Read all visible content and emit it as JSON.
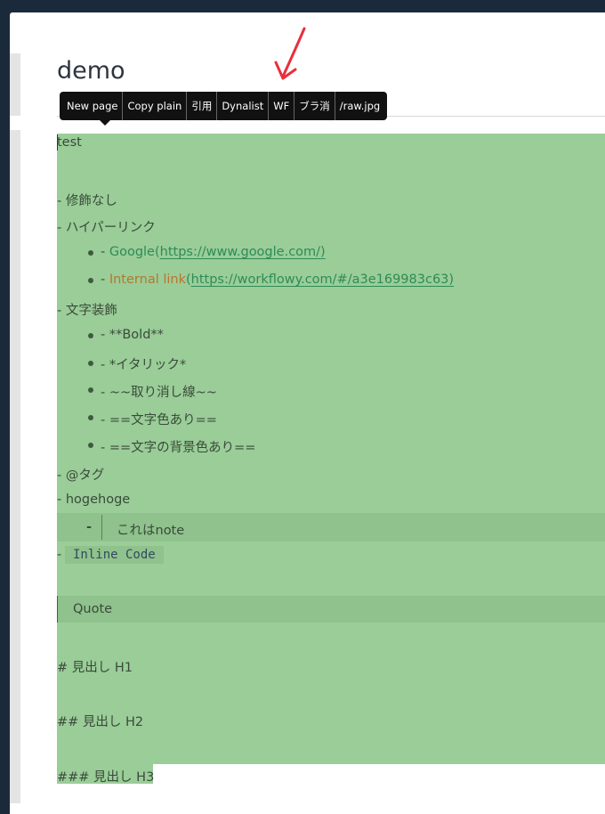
{
  "page": {
    "title": "demo"
  },
  "toolbar": {
    "buttons": [
      "New page",
      "Copy plain",
      "引用",
      "Dynalist",
      "WF",
      "ブラ消",
      "/raw.jpg"
    ]
  },
  "colors": {
    "background": "#1b2a3a",
    "editor_highlight": "#9acd98",
    "arrow": "#e8303c"
  },
  "editor": {
    "line_test": "test",
    "line_plain": "- 修飾なし",
    "line_hyperlink": "- ハイパーリンク",
    "google": {
      "prefix": "- ",
      "text": "Google",
      "open": "(",
      "url": "https://www.google.com/)"
    },
    "internal": {
      "prefix": "- ",
      "text": "Internal link",
      "open": "(",
      "url": "https://workflowy.com/#/a3e169983c63)"
    },
    "line_deco": "- 文字装飾",
    "deco_items": [
      "- **Bold**",
      "- *イタリック*",
      "- ~~取り消し線~~",
      "- ==文字色あり==",
      "- ==文字の背景色あり=="
    ],
    "line_tag": "- @タグ",
    "line_hoge": "- hogehoge",
    "note_dash": "-",
    "note_text": "これはnote",
    "inline_prefix": "-",
    "inline_code": "Inline Code",
    "quote_text": "Quote",
    "h1": "# 見出し H1",
    "h2": "## 見出し H2",
    "h3": "### 見出し H3"
  }
}
